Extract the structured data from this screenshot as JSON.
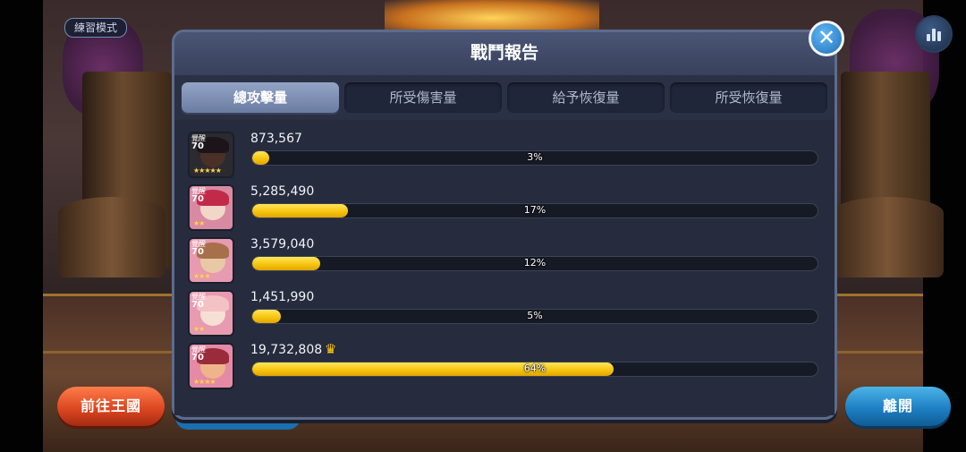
{
  "practice_mode_label": "練習模式",
  "panel": {
    "title": "戰鬥報告",
    "close_icon": "close-icon",
    "tabs": [
      {
        "label": "總攻擊量",
        "active": true
      },
      {
        "label": "所受傷害量",
        "active": false
      },
      {
        "label": "給予恢復量",
        "active": false
      },
      {
        "label": "所受恢復量",
        "active": false
      }
    ],
    "rows": [
      {
        "rank": "覺醒",
        "level": "70",
        "value": "873,567",
        "percent_label": "3%",
        "fill_percent": 3,
        "crown": false,
        "avatar_skin": "#4a3026",
        "avatar_hair": "#1c1418",
        "avatar_bg": "#2b2a30",
        "stars": "★★★★★"
      },
      {
        "rank": "覺醒",
        "level": "70",
        "value": "5,285,490",
        "percent_label": "17%",
        "fill_percent": 17,
        "crown": false,
        "avatar_skin": "#f2d7c8",
        "avatar_hair": "#c22a4a",
        "avatar_bg": "#d98aa3",
        "stars": "★★"
      },
      {
        "rank": "覺醒",
        "level": "70",
        "value": "3,579,040",
        "percent_label": "12%",
        "fill_percent": 12,
        "crown": false,
        "avatar_skin": "#e9c8a6",
        "avatar_hair": "#a7704a",
        "avatar_bg": "#e79ab0",
        "stars": "★★★"
      },
      {
        "rank": "覺醒",
        "level": "70",
        "value": "1,451,990",
        "percent_label": "5%",
        "fill_percent": 5,
        "crown": false,
        "avatar_skin": "#f6e0d6",
        "avatar_hair": "#f4c2c4",
        "avatar_bg": "#e79ab0",
        "stars": "★★"
      },
      {
        "rank": "覺醒",
        "level": "70",
        "value": "19,732,808",
        "percent_label": "64%",
        "fill_percent": 64,
        "crown": true,
        "crown_icon": "crown-icon",
        "avatar_skin": "#efb58a",
        "avatar_hair": "#9a2b3a",
        "avatar_bg": "#e58aa6",
        "stars": "★★★★"
      }
    ]
  },
  "buttons": {
    "go_kingdom": "前往王國",
    "leave": "離開"
  },
  "stats_icon": "bar-chart-icon",
  "colors": {
    "bar_fill": "#f6c20c",
    "active_tab": "#7d8eb3",
    "kingdom_button": "#d9441f",
    "leave_button": "#1b7cc0"
  }
}
